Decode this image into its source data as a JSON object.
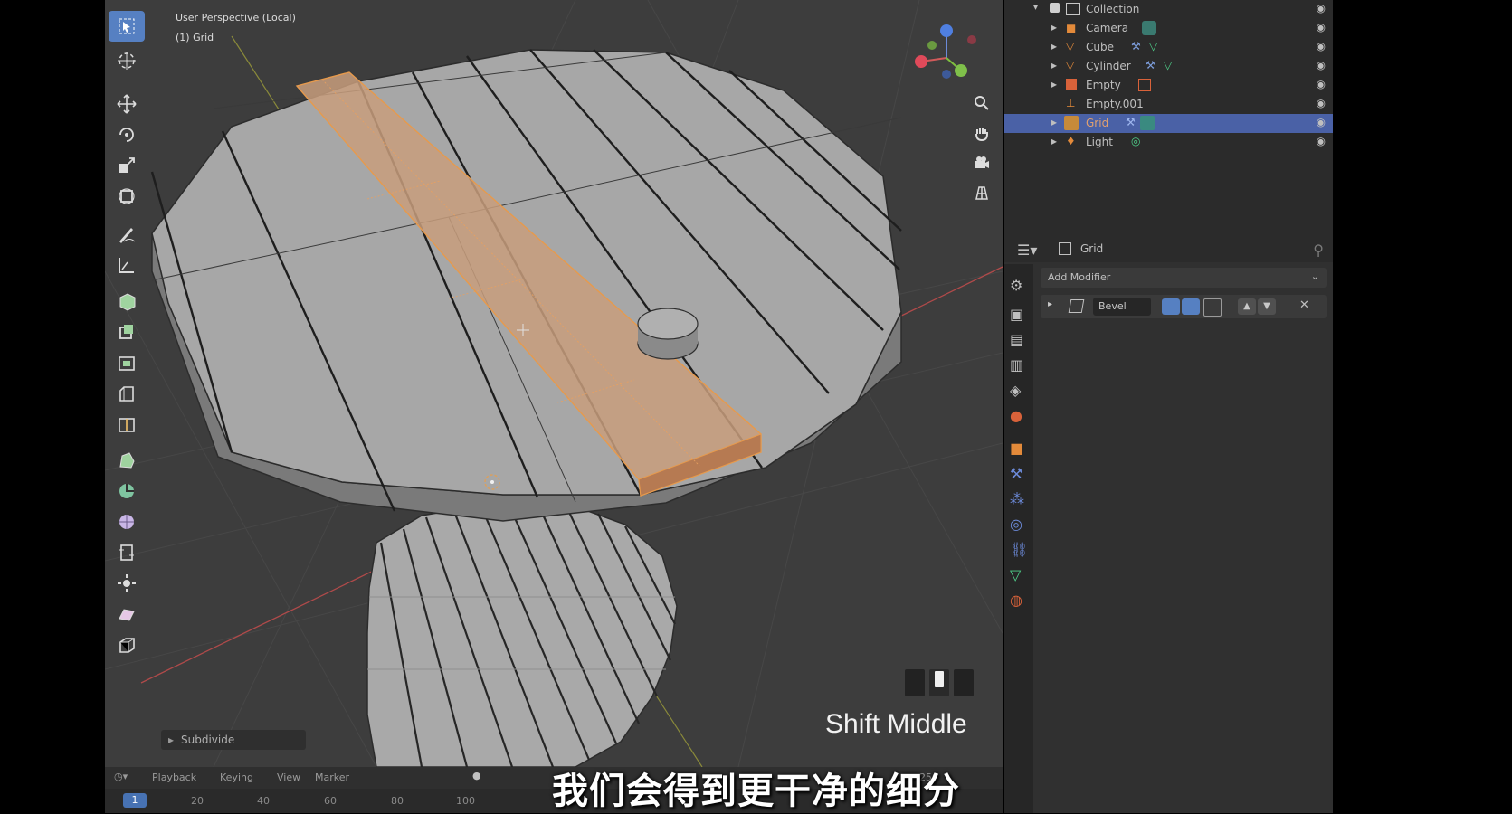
{
  "viewport": {
    "view_name": "User Perspective (Local)",
    "object_label": "(1) Grid",
    "last_operation": "Subdivide",
    "key_hint": "Shift Middle"
  },
  "toolbar": {
    "tools": [
      "select-box",
      "cursor",
      "move",
      "rotate",
      "scale",
      "transform",
      "annotate",
      "measure",
      "add-cube",
      "extrude-region",
      "inset-faces",
      "bevel",
      "loop-cut",
      "knife",
      "poly-build",
      "spin",
      "smooth",
      "edge-slide",
      "shrink-fatten",
      "shear",
      "rip-region"
    ],
    "active": "select-box"
  },
  "outliner": {
    "items": [
      {
        "label": "Collection",
        "icon": "collection-icon"
      },
      {
        "label": "Camera",
        "icon": "camera-icon"
      },
      {
        "label": "Cube",
        "icon": "mesh-icon"
      },
      {
        "label": "Cylinder",
        "icon": "mesh-icon"
      },
      {
        "label": "Empty",
        "icon": "empty-icon"
      },
      {
        "label": "Empty.001",
        "icon": "empty-icon"
      },
      {
        "label": "Grid",
        "icon": "mesh-icon",
        "selected": true
      },
      {
        "label": "Light",
        "icon": "light-icon"
      }
    ]
  },
  "properties": {
    "object_name": "Grid",
    "add_modifier_label": "Add Modifier",
    "modifier_name": "Bevel"
  },
  "timeline": {
    "menus": [
      "Playback",
      "Keying",
      "View",
      "Marker"
    ],
    "current_frame": "1",
    "end_frame": "250",
    "ticks": [
      "20",
      "40",
      "60",
      "80",
      "100"
    ]
  },
  "subtitle": "我们会得到更干净的细分",
  "colors": {
    "viewport_bg": "#3d3d3d",
    "selection": "#e8a060",
    "active_blue": "#4a61a6"
  }
}
